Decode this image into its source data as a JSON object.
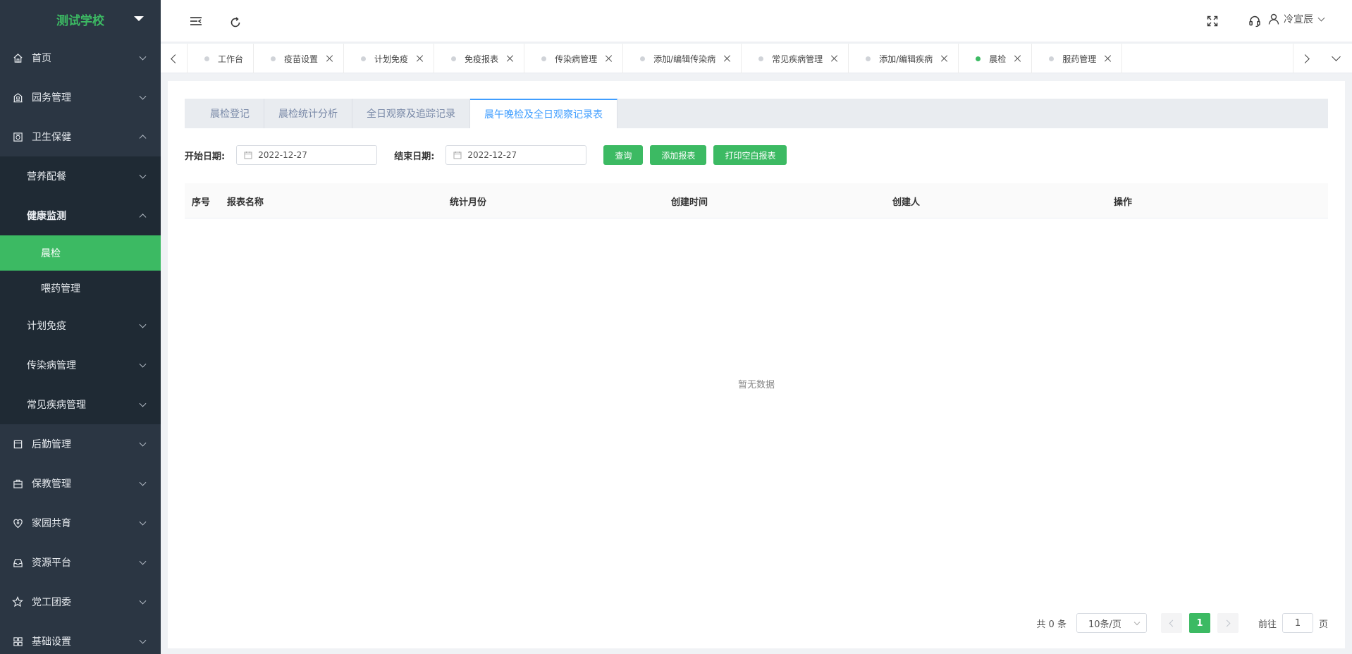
{
  "brand": {
    "name": "测试学校"
  },
  "sidebar": {
    "items": [
      {
        "label": "首页",
        "icon": "home-icon"
      },
      {
        "label": "园务管理",
        "icon": "building-icon"
      },
      {
        "label": "卫生保健",
        "icon": "medical-box-icon"
      },
      {
        "label": "营养配餐"
      },
      {
        "label": "健康监测"
      },
      {
        "label": "晨检"
      },
      {
        "label": "喂药管理"
      },
      {
        "label": "计划免疫"
      },
      {
        "label": "传染病管理"
      },
      {
        "label": "常见疾病管理"
      },
      {
        "label": "后勤管理",
        "icon": "logistics-icon"
      },
      {
        "label": "保教管理",
        "icon": "teaching-icon"
      },
      {
        "label": "家园共育",
        "icon": "heart-location-icon"
      },
      {
        "label": "资源平台",
        "icon": "inbox-icon"
      },
      {
        "label": "党工团委",
        "icon": "star-icon"
      },
      {
        "label": "基础设置",
        "icon": "grid-icon"
      }
    ]
  },
  "header": {
    "user_name": "冷宣辰"
  },
  "tabs": [
    {
      "label": "工作台",
      "closable": false
    },
    {
      "label": "疫苗设置",
      "closable": true
    },
    {
      "label": "计划免疫",
      "closable": true
    },
    {
      "label": "免疫报表",
      "closable": true
    },
    {
      "label": "传染病管理",
      "closable": true
    },
    {
      "label": "添加/编辑传染病",
      "closable": true
    },
    {
      "label": "常见疾病管理",
      "closable": true
    },
    {
      "label": "添加/编辑疾病",
      "closable": true
    },
    {
      "label": "晨检",
      "closable": true,
      "active": true
    },
    {
      "label": "服药管理",
      "closable": true
    }
  ],
  "subtabs": [
    {
      "label": "晨检登记"
    },
    {
      "label": "晨检统计分析"
    },
    {
      "label": "全日观察及追踪记录"
    },
    {
      "label": "晨午晚检及全日观察记录表",
      "active": true
    }
  ],
  "filters": {
    "start_label": "开始日期:",
    "start_value": "2022-12-27",
    "end_label": "结束日期:",
    "end_value": "2022-12-27",
    "query_button": "查询",
    "add_button": "添加报表",
    "print_button": "打印空白报表"
  },
  "table": {
    "columns": [
      "序号",
      "报表名称",
      "统计月份",
      "创建时间",
      "创建人",
      "操作"
    ],
    "empty_text": "暂无数据"
  },
  "pagination": {
    "total_text": "共 0 条",
    "page_size": "10条/页",
    "current_page": "1",
    "goto_label": "前往",
    "goto_value": "1",
    "page_unit": "页"
  },
  "colors": {
    "sidebar_bg": "#2b3643",
    "accent_green": "#3cba63",
    "link_blue": "#409eff"
  }
}
